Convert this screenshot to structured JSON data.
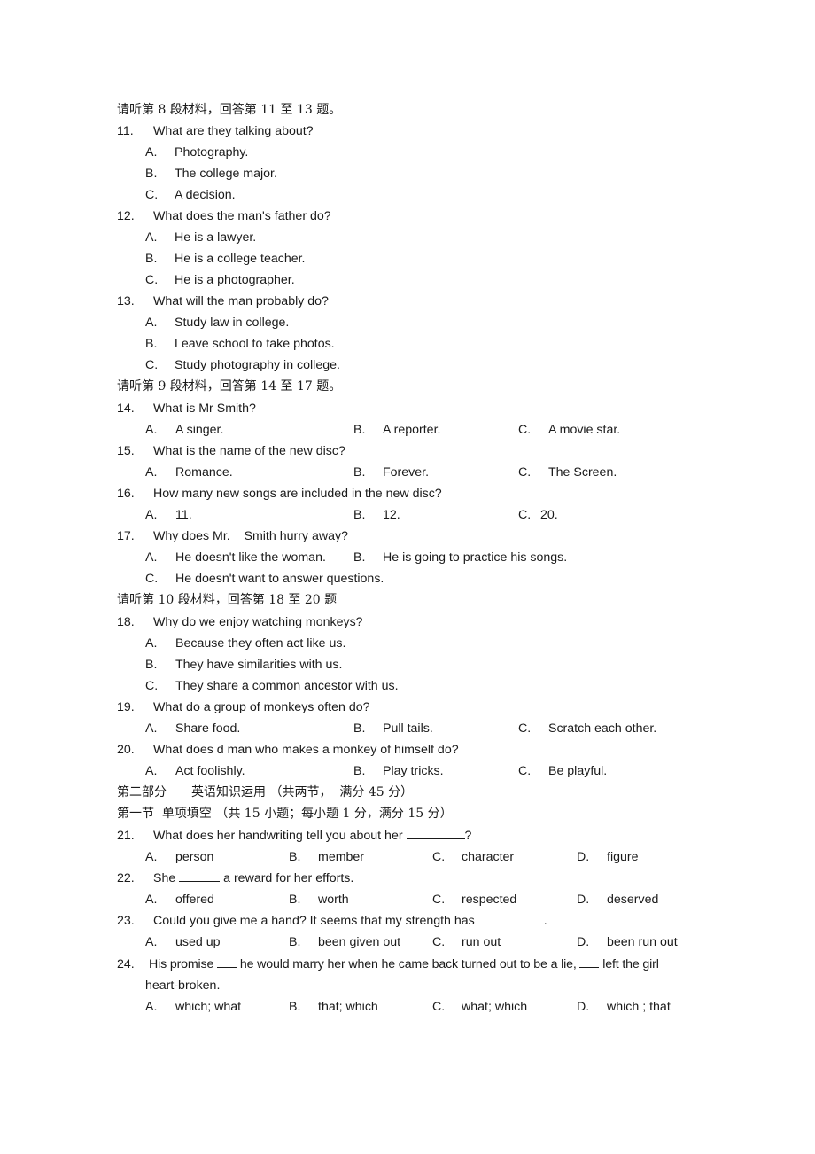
{
  "sections": [
    {
      "type": "heading",
      "text": "请听第 8 段材料，回答第 11 至 13 题。"
    },
    {
      "type": "heading2",
      "text": "请听第 9 段材料，回答第 14 至 17 题。"
    },
    {
      "type": "heading3",
      "text": "请听第 10 段材料，回答第 18 至 20 题"
    },
    {
      "type": "part",
      "text": "第二部分　　英语知识运用 （共两节，  满分 45 分）"
    },
    {
      "type": "subpart",
      "text": "第一节  单项填空 （共 15 小题；每小题 1 分，满分 15 分）"
    }
  ],
  "questions": {
    "q11": {
      "num": "11.",
      "text": "What are they talking about?",
      "options": [
        {
          "letter": "A.",
          "text": "Photography."
        },
        {
          "letter": "B.",
          "text": "The college major."
        },
        {
          "letter": "C.",
          "text": "A decision."
        }
      ]
    },
    "q12": {
      "num": "12.",
      "text": "What does the man's father do?",
      "options": [
        {
          "letter": "A.",
          "text": "He is a lawyer."
        },
        {
          "letter": "B.",
          "text": "He is a college teacher."
        },
        {
          "letter": "C.",
          "text": "He is a photographer."
        }
      ]
    },
    "q13": {
      "num": "13.",
      "text": "What will the man probably do?",
      "options": [
        {
          "letter": "A.",
          "text": "Study law in college."
        },
        {
          "letter": "B.",
          "text": "Leave school to take photos."
        },
        {
          "letter": "C.",
          "text": "Study photography in college."
        }
      ]
    },
    "q14": {
      "num": "14.",
      "text": "What is Mr Smith?",
      "options": [
        {
          "letter": "A.",
          "text": "A singer."
        },
        {
          "letter": "B.",
          "text": "A reporter."
        },
        {
          "letter": "C.",
          "text": "A movie star."
        }
      ]
    },
    "q15": {
      "num": "15.",
      "text": "What is the name of the new disc?",
      "options": [
        {
          "letter": "A.",
          "text": "Romance."
        },
        {
          "letter": "B.",
          "text": "Forever."
        },
        {
          "letter": "C.",
          "text": "The Screen."
        }
      ]
    },
    "q16": {
      "num": "16.",
      "text": "How many new songs are included in the new disc?",
      "options": [
        {
          "letter": "A.",
          "text": "11."
        },
        {
          "letter": "B.",
          "text": "12."
        },
        {
          "letter": "C.",
          "text": "20."
        }
      ]
    },
    "q17": {
      "num": "17.",
      "text": "Why does Mr.    Smith hurry away?",
      "options": [
        {
          "letter": "A.",
          "text": "He doesn't like the woman."
        },
        {
          "letter": "B.",
          "text": "He is going to practice his songs."
        },
        {
          "letter": "C.",
          "text": "He doesn't want to answer questions."
        }
      ]
    },
    "q18": {
      "num": "18.",
      "text": "Why do we enjoy watching monkeys?",
      "options": [
        {
          "letter": "A.",
          "text": "Because they often act like us."
        },
        {
          "letter": "B.",
          "text": "They have similarities with us."
        },
        {
          "letter": "C.",
          "text": "They share a common ancestor with us."
        }
      ]
    },
    "q19": {
      "num": "19.",
      "text": "What do a group of monkeys often do?",
      "options": [
        {
          "letter": "A.",
          "text": "Share food."
        },
        {
          "letter": "B.",
          "text": "Pull tails."
        },
        {
          "letter": "C.",
          "text": "Scratch each other."
        }
      ]
    },
    "q20": {
      "num": "20.",
      "text": "What does d man who makes a monkey of himself do?",
      "options": [
        {
          "letter": "A.",
          "text": "Act foolishly."
        },
        {
          "letter": "B.",
          "text": "Play tricks."
        },
        {
          "letter": "C.",
          "text": "Be playful."
        }
      ]
    },
    "q21": {
      "num": "21.",
      "text_before": "What does her handwriting tell you about her ",
      "text_after": "?",
      "options": [
        {
          "letter": "A.",
          "text": "person"
        },
        {
          "letter": "B.",
          "text": "member"
        },
        {
          "letter": "C.",
          "text": "character"
        },
        {
          "letter": "D.",
          "text": "figure"
        }
      ]
    },
    "q22": {
      "num": "22.",
      "text_before": "She ",
      "text_after": " a reward for her efforts.",
      "options": [
        {
          "letter": "A.",
          "text": "offered"
        },
        {
          "letter": "B.",
          "text": "worth"
        },
        {
          "letter": "C.",
          "text": "respected"
        },
        {
          "letter": "D.",
          "text": "deserved"
        }
      ]
    },
    "q23": {
      "num": "23.",
      "text_before": "Could you give me a hand? It seems that my strength has ",
      "text_after": ".",
      "options": [
        {
          "letter": "A.",
          "text": "used up"
        },
        {
          "letter": "B.",
          "text": "been given out"
        },
        {
          "letter": "C.",
          "text": "run out"
        },
        {
          "letter": "D.",
          "text": "been run out"
        }
      ]
    },
    "q24": {
      "num": "24.",
      "text_before": "His promise ",
      "text_middle": " he would marry her when he came back turned out to be a lie, ",
      "text_after": " left the girl",
      "text_cont": "heart-broken.",
      "options": [
        {
          "letter": "A.",
          "text": "which; what"
        },
        {
          "letter": "B.",
          "text": "that; which"
        },
        {
          "letter": "C.",
          "text": "what; which"
        },
        {
          "letter": "D.",
          "text": "which ; that"
        }
      ]
    }
  }
}
